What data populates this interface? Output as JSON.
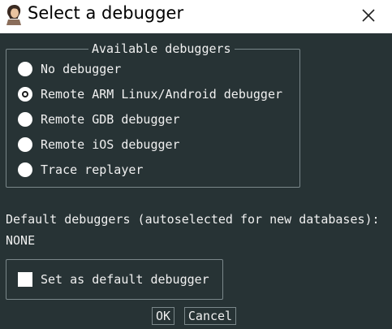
{
  "window": {
    "title": "Select a debugger"
  },
  "group": {
    "title": "Available debuggers",
    "options": [
      {
        "label": "No debugger",
        "checked": false
      },
      {
        "label": "Remote ARM Linux/Android debugger",
        "checked": true
      },
      {
        "label": "Remote GDB debugger",
        "checked": false
      },
      {
        "label": "Remote iOS debugger",
        "checked": false
      },
      {
        "label": "Trace replayer",
        "checked": false
      }
    ]
  },
  "default_info": {
    "label": "Default debuggers (autoselected for new databases):",
    "value": "NONE"
  },
  "checkbox": {
    "label": "Set as default debugger",
    "checked": false
  },
  "buttons": {
    "ok": "OK",
    "cancel": "Cancel"
  },
  "colors": {
    "background": "#273335",
    "titlebar": "#ffffff",
    "text": "#f0f0f0",
    "border": "#7a878a"
  },
  "icons": {
    "app": "app-icon",
    "close": "close-icon"
  }
}
